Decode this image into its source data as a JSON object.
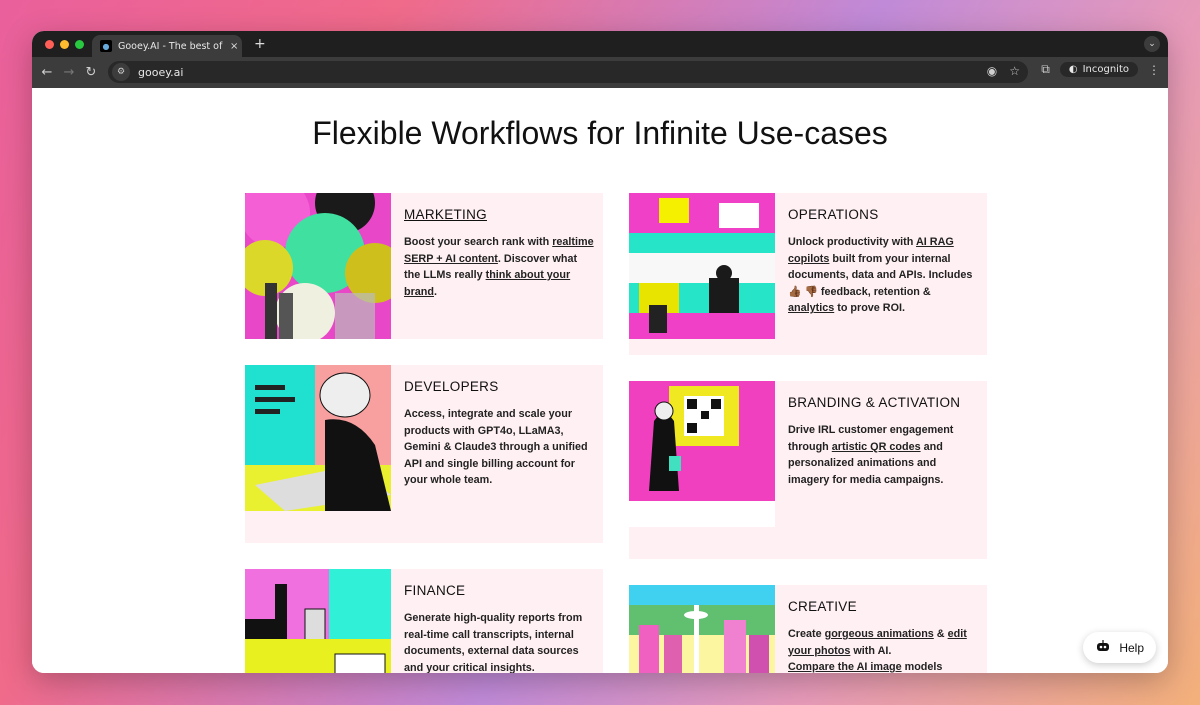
{
  "browser": {
    "tab_title": "Gooey.AI - The best of privat",
    "tab_close": "×",
    "new_tab": "+",
    "url": "gooey.ai",
    "incognito_label": "Incognito"
  },
  "page": {
    "heading": "Flexible Workflows for Infinite Use-cases"
  },
  "cards": [
    {
      "title": "MARKETING",
      "parts": [
        "Boost your search rank with ",
        "realtime SERP + AI content",
        ". Discover what the LLMs really ",
        "think about your brand",
        "."
      ]
    },
    {
      "title": "OPERATIONS",
      "parts": [
        "Unlock productivity with ",
        "AI RAG copilots",
        " built from your internal documents, data and APIs. Includes 👍🏾 👎🏾 feedback, retention & ",
        "analytics",
        " to prove ROI."
      ]
    },
    {
      "title": "DEVELOPERS",
      "parts": [
        "Access, integrate and scale your products with GPT4o, LLaMA3, Gemini & Claude3 through a unified API and single billing account for your whole team."
      ]
    },
    {
      "title": "BRANDING & ACTIVATION",
      "parts": [
        "Drive IRL customer engagement through ",
        "artistic QR codes",
        " and personalized animations and imagery for media campaigns."
      ]
    },
    {
      "title": "FINANCE",
      "parts": [
        "Generate high-quality reports from real-time call transcripts, internal documents, external data sources and your critical insights."
      ]
    },
    {
      "title": "CREATIVE",
      "parts": [
        "Create ",
        "gorgeous animations",
        " & ",
        "edit your photos",
        " with AI. ",
        "Compare the AI image",
        " models (DallE,"
      ]
    }
  ],
  "help": {
    "label": "Help"
  }
}
